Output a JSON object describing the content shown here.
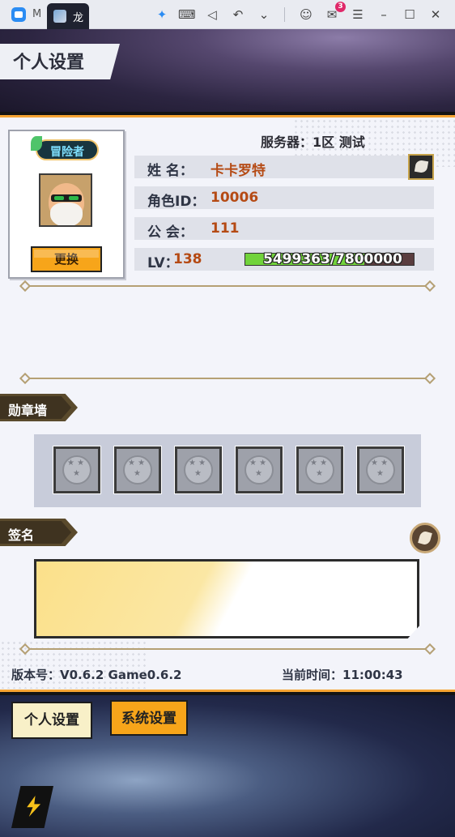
{
  "titlebar": {
    "app_title": "M",
    "tab_title": "龙",
    "notification_count": "3"
  },
  "page": {
    "title": "个人设置"
  },
  "profile": {
    "rank_badge": "冒险者",
    "change_label": "更换",
    "server": "服务器：1区 测试",
    "name_key": "姓 名：",
    "name_value": "卡卡罗特",
    "role_key": "角色ID：",
    "role_value": "10006",
    "guild_key": "公 会：",
    "guild_value": "111",
    "lv_key": "LV：",
    "lv_value": "138",
    "exp_text": "5499363/7800000",
    "exp_fraction": 0.705
  },
  "medals": {
    "section_label": "勋章墙",
    "slots": [
      "",
      "",
      "",
      "",
      "",
      ""
    ]
  },
  "signature": {
    "section_label": "签名",
    "text": ""
  },
  "footer": {
    "version": "版本号：V0.6.2 Game0.6.2",
    "time": "当前时间：11:00:43"
  },
  "nav": {
    "personal_label": "个人设置",
    "system_label": "系统设置"
  },
  "colors": {
    "accent_orange": "#f7a51a",
    "value_red": "#b54a14",
    "exp_green": "#71d33b"
  }
}
